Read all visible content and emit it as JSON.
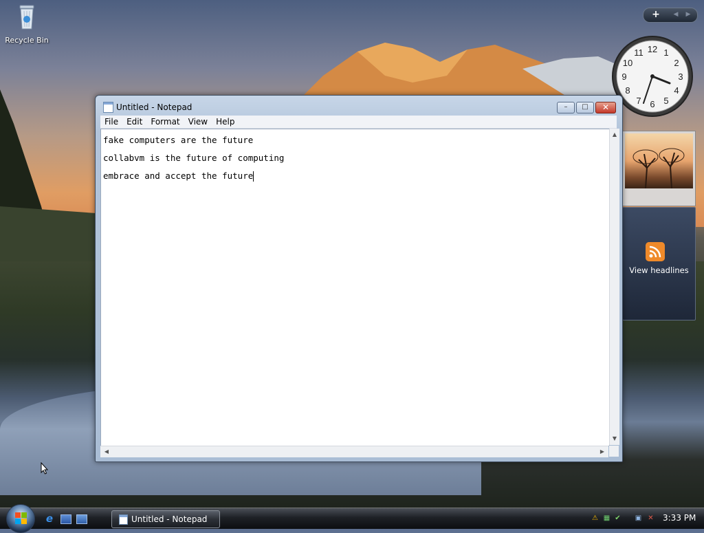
{
  "desktop": {
    "recycle_bin_label": "Recycle Bin"
  },
  "gadgets": {
    "add_label": "+",
    "prev_label": "◀",
    "next_label": "▶",
    "clock_numbers": [
      "12",
      "1",
      "2",
      "3",
      "4",
      "5",
      "6",
      "7",
      "8",
      "9",
      "10",
      "11"
    ],
    "clock_time": "3:33",
    "feed_label": "View headlines"
  },
  "notepad": {
    "title": "Untitled - Notepad",
    "menu": [
      "File",
      "Edit",
      "Format",
      "View",
      "Help"
    ],
    "lines": [
      "fake computers are the future",
      "collabvm is the future of computing",
      "embrace and accept the future"
    ],
    "controls": {
      "minimize": "–",
      "maximize": "□",
      "close": "✕"
    }
  },
  "taskbar": {
    "start_label": "Start",
    "task_button_label": "Untitled - Notepad",
    "clock": "3:33 PM",
    "tray_icons": [
      "shield-warning-icon",
      "network-icon",
      "checkmark-icon",
      "connection-icon",
      "volume-muted-icon"
    ]
  },
  "colors": {
    "accent": "#4a6d9c",
    "close_button": "#c4382a"
  }
}
